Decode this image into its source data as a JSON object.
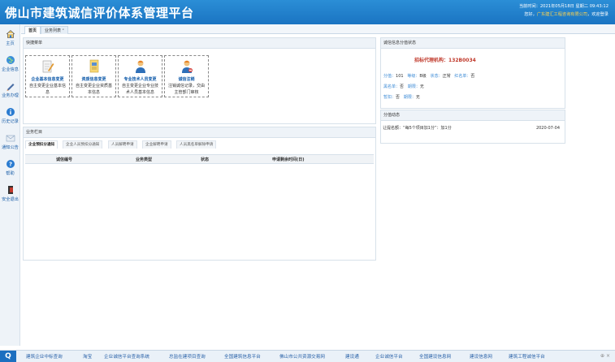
{
  "app": {
    "title": "佛山市建筑诚信评价体系管理平台",
    "datetime": "当前时间：2021年05月18日 星期二 09:43:12",
    "greeting_prefix": "您好，",
    "company": "广东建汇工程咨询有限公司",
    "greeting_suffix": "，欢迎登录"
  },
  "sidebar": {
    "items": [
      {
        "label": "主页",
        "icon": "home-icon"
      },
      {
        "label": "企业信息",
        "icon": "globe-icon"
      },
      {
        "label": "业务办理",
        "icon": "pen-icon"
      },
      {
        "label": "历史记录",
        "icon": "info-icon"
      },
      {
        "label": "通知公告",
        "icon": "mail-icon"
      },
      {
        "label": "帮助",
        "icon": "help-icon"
      },
      {
        "label": "安全退出",
        "icon": "exit-icon"
      }
    ]
  },
  "tabs": [
    {
      "label": "首页"
    },
    {
      "label": "业务列表 ˣ"
    }
  ],
  "quick_menu": {
    "title": "快捷菜单",
    "cards": [
      {
        "title": "企业基本信息变更",
        "desc": "自主变更企业基本信息",
        "icon": "edit-document-icon"
      },
      {
        "title": "资质信息变更",
        "desc": "自主变更企业资质基本信息",
        "icon": "certificate-icon"
      },
      {
        "title": "专业技术人员变更",
        "desc": "自主变更企业专业技术人员基本信息",
        "icon": "person-icon"
      },
      {
        "title": "诚信注销",
        "desc": "注销诚信记录，交由主管部门审核",
        "icon": "person-remove-icon"
      }
    ]
  },
  "business": {
    "title": "业务栏目",
    "subtabs": [
      "企业预扣分通知",
      "企业人员预扣分通知",
      "人员解聘申请",
      "企业解聘申请",
      "人员黑名单解除申请"
    ],
    "columns": [
      "诚信编号",
      "业务类型",
      "状态",
      "申请剩余时间(日)"
    ]
  },
  "credit_status": {
    "title": "诚信信息分值状态",
    "agency_label": "招标代理机构：",
    "agency_code": "132B0034",
    "rows": [
      [
        {
          "k": "分值：",
          "v": "101"
        },
        {
          "k": "等级：",
          "v": "B级"
        },
        {
          "k": "状态：",
          "v": "正常"
        },
        {
          "k": "红名单：",
          "v": "否"
        }
      ],
      [
        {
          "k": "黑名单：",
          "v": "否"
        },
        {
          "k": "期限：",
          "v": "无"
        }
      ],
      [
        {
          "k": "暂扣：",
          "v": "否"
        },
        {
          "k": "期限：",
          "v": "无"
        }
      ]
    ]
  },
  "score_dynamics": {
    "title": "分值动态",
    "items": [
      {
        "text": "让提名额：“每5个项目加1分”：加1分",
        "date": "2020-07-04"
      }
    ]
  },
  "taskbar": {
    "start": "Q",
    "links": [
      "建筑企业中标查询",
      "淘宝",
      "企业诚信平台查询系统",
      "总监在建项目查询",
      "全国建筑信息平台",
      "佛山市公共资源交易网",
      "建设通",
      "企业诚信平台",
      "全国建设信息网",
      "建设信息网",
      "建筑工程诚信平台"
    ],
    "tray": "⊕ ×"
  }
}
